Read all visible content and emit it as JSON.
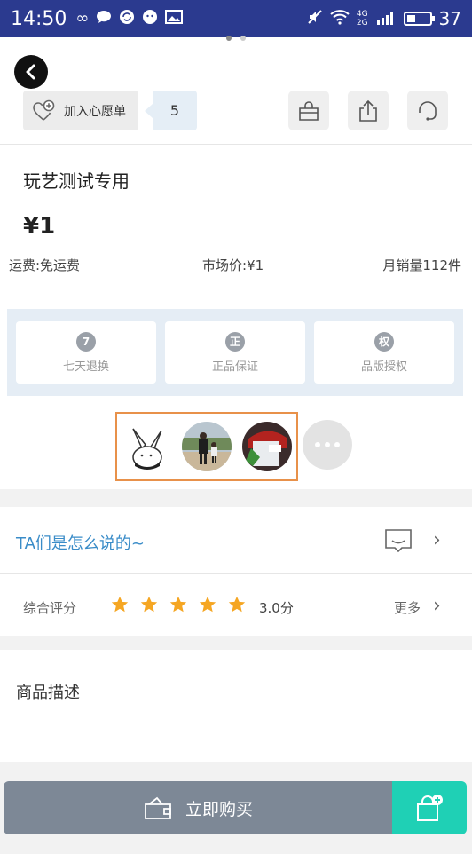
{
  "status_bar": {
    "time": "14:50",
    "network_top": "4G",
    "network_bottom": "2G",
    "battery": "37",
    "battery_level": 0.37,
    "icons": [
      "infinity-icon",
      "chat-bubble-icon",
      "sync-icon",
      "emoji-icon",
      "image-icon",
      "mute-icon",
      "wifi-icon",
      "signal-icon",
      "battery-icon"
    ]
  },
  "carousel": {
    "page_count": 2,
    "active_index": 0
  },
  "actions": {
    "wishlist_label": "加入心愿单",
    "wishlist_count": "5"
  },
  "product": {
    "title": "玩艺测试专用",
    "price": "¥1",
    "shipping": "运费:免运费",
    "market_price": "市场价:¥1",
    "monthly_sales": "月销量112件"
  },
  "guarantees": [
    {
      "badge": "7",
      "label": "七天退换"
    },
    {
      "badge": "正",
      "label": "正品保证"
    },
    {
      "badge": "权",
      "label": "品版授权"
    }
  ],
  "reviews": {
    "heading": "TA们是怎么说的~",
    "rating_label": "综合评分",
    "star_count": 5,
    "score": "3.0分",
    "more_label": "更多"
  },
  "description": {
    "heading": "商品描述"
  },
  "bottom_bar": {
    "buy_label": "立即购买"
  },
  "colors": {
    "status_bar": "#2b3a8f",
    "accent_blue": "#3a8cc8",
    "star": "#f5a623",
    "buy_bar": "#7d8896",
    "cart": "#1fd0b5",
    "highlight_border": "#e8914a"
  }
}
